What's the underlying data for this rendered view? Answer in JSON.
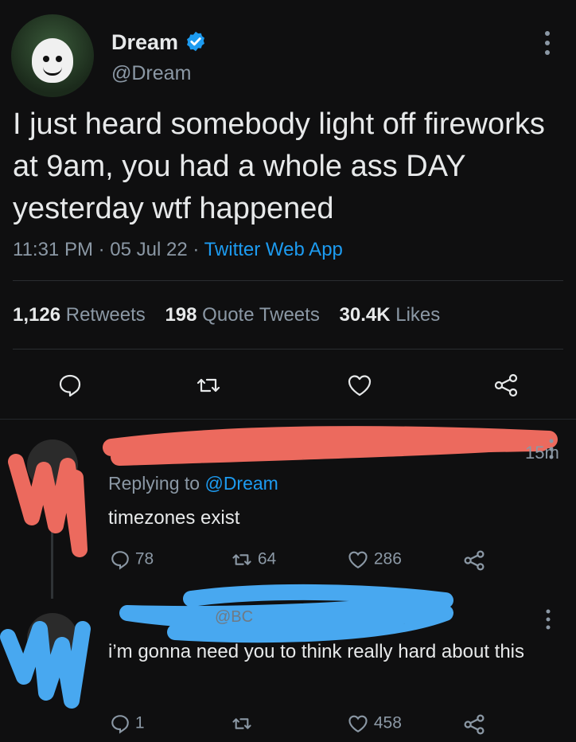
{
  "tweet": {
    "name": "Dream",
    "handle": "@Dream",
    "text": "I just heard somebody light off fireworks at 9am, you had a whole ass DAY yesterday wtf happened",
    "time": "11:31 PM · 05 Jul 22 · ",
    "app": "Twitter Web App",
    "stats": {
      "retweets_count": "1,126",
      "retweets_label": "Retweets",
      "quotes_count": "198",
      "quotes_label": "Quote Tweets",
      "likes_count": "30.4K",
      "likes_label": "Likes"
    },
    "icons": [
      "reply-icon",
      "retweet-icon",
      "like-icon",
      "share-icon"
    ],
    "verified_color": "#1d9bf0"
  },
  "replies": [
    {
      "time": "15m",
      "replying_prefix": "Replying to ",
      "replying_to": "@Dream",
      "text": "timezones exist",
      "replies_count": "78",
      "retweets_count": "64",
      "likes_count": "286",
      "scribble_color": "#ec6a5e"
    },
    {
      "handle_fragment": "@BC",
      "text": "i’m gonna need you to think really hard about this",
      "replies_count": "1",
      "likes_count": "458",
      "scribble_color": "#48a8f0"
    }
  ]
}
